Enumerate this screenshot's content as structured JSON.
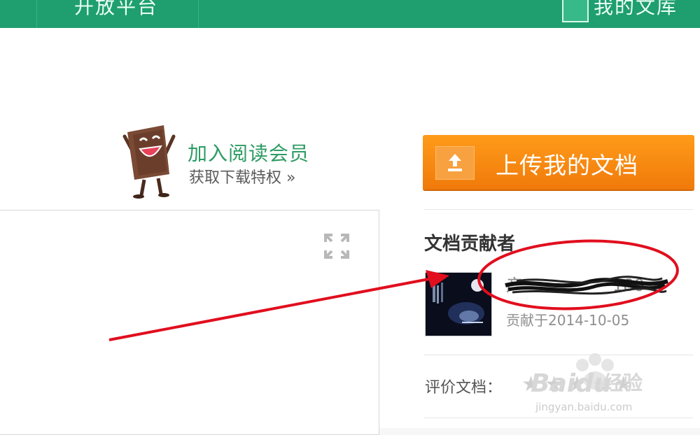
{
  "topbar": {
    "open_platform": "开放平台",
    "my_library": "我的文库"
  },
  "promo": {
    "title": "加入阅读会员",
    "subtitle": "获取下载特权 »"
  },
  "upload": {
    "label": "上传我的文档"
  },
  "contributor": {
    "title": "文档贡献者",
    "name_suffix": "180",
    "date": "贡献于2014-10-05"
  },
  "rating": {
    "label": "评价文档："
  },
  "watermark": {
    "brand": "Baidu",
    "jingyan": "经验",
    "url": "jingyan.baidu.com"
  },
  "colors": {
    "topbar": "#1f9e6f",
    "promo_green": "#2d9b63",
    "upload_orange": "#f58a10",
    "annotation_red": "#e10e1e"
  }
}
